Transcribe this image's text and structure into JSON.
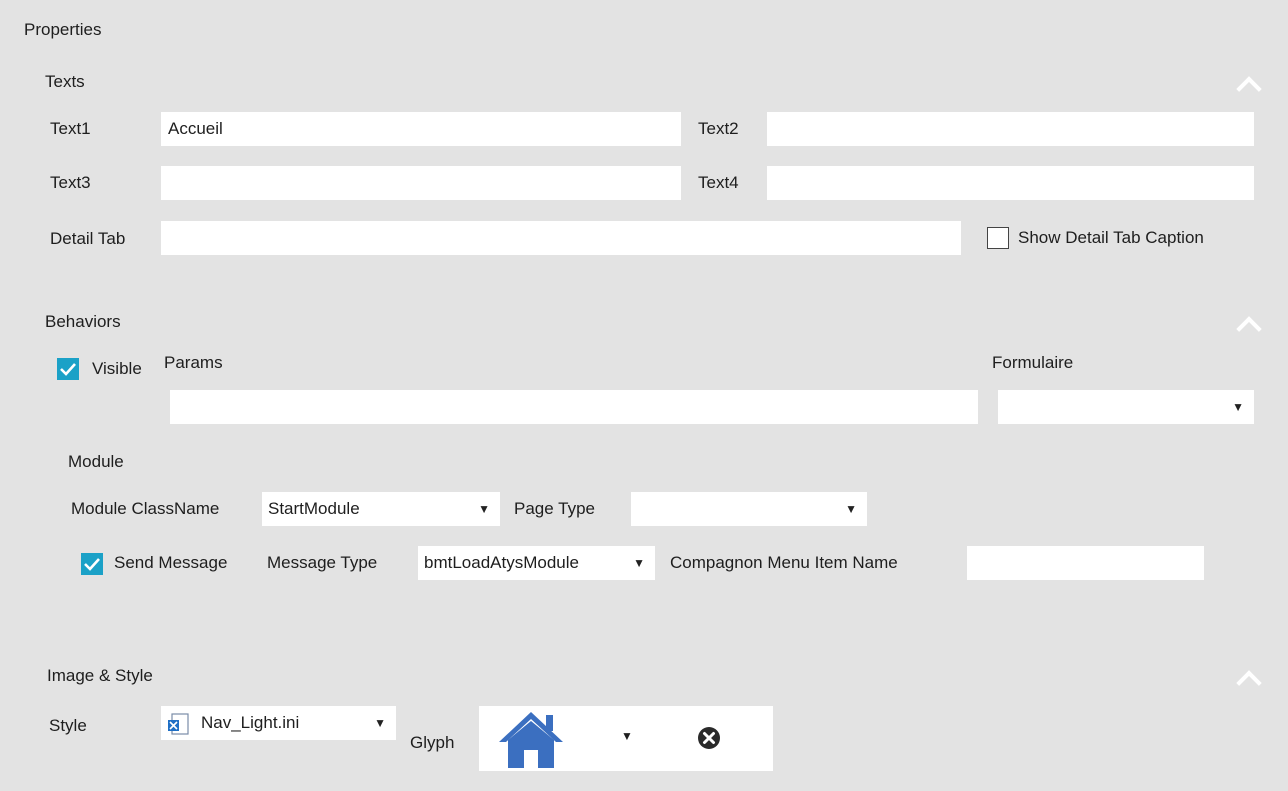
{
  "panel": {
    "title": "Properties"
  },
  "texts": {
    "header": "Texts",
    "text1_label": "Text1",
    "text1_value": "Accueil",
    "text2_label": "Text2",
    "text2_value": "",
    "text3_label": "Text3",
    "text3_value": "",
    "text4_label": "Text4",
    "text4_value": "",
    "detail_tab_label": "Detail Tab",
    "detail_tab_value": "",
    "show_caption_label": "Show Detail Tab Caption",
    "show_caption_checked": false
  },
  "behaviors": {
    "header": "Behaviors",
    "visible_label": "Visible",
    "visible_checked": true,
    "params_label": "Params",
    "params_value": "",
    "formulaire_label": "Formulaire",
    "formulaire_value": "",
    "module": {
      "header": "Module",
      "classname_label": "Module ClassName",
      "classname_value": "StartModule",
      "page_type_label": "Page Type",
      "page_type_value": "",
      "send_message_label": "Send Message",
      "send_message_checked": true,
      "message_type_label": "Message Type",
      "message_type_value": "bmtLoadAtysModule",
      "compagnon_label": "Compagnon Menu Item Name",
      "compagnon_value": ""
    }
  },
  "image_style": {
    "header": "Image & Style",
    "style_label": "Style",
    "style_value": "Nav_Light.ini",
    "glyph_label": "Glyph",
    "glyph_icon": "home-icon",
    "clear_icon": "clear-icon"
  },
  "colors": {
    "background": "#e3e3e3",
    "checkbox_accent": "#1ba1c7",
    "glyph_blue": "#3b6fc0"
  }
}
